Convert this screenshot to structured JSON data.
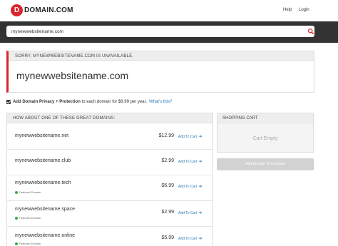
{
  "header": {
    "logo_badge": "D",
    "logo_text": "DOMAIN.COM",
    "nav": {
      "help": "Help",
      "login": "Login"
    }
  },
  "search": {
    "value": "mynewwebsitename.com",
    "icon": "search-icon"
  },
  "unavailable": {
    "message": "SORRY, MYNEWWEBSITENAME.COM IS UNAVAILABLE.",
    "domain": "mynewwebsitename.com"
  },
  "privacy": {
    "label_bold": "Add Domain Privacy + Protection",
    "label_rest": "to each domain for $8.99 per year.",
    "link": "What's this?"
  },
  "suggestions": {
    "header": "HOW ABOUT ONE OF THESE GREAT DOMAINS:",
    "items": [
      {
        "name": "mynewwebsitename.net",
        "price": "$12.99",
        "cta": "Add To Cart",
        "featured": ""
      },
      {
        "name": "mynewwebsitename.club",
        "price": "$2.99",
        "cta": "Add To Cart",
        "featured": ""
      },
      {
        "name": "mynewwebsitename.tech",
        "price": "$6.99",
        "cta": "Add To Cart",
        "featured": "Featured Domain"
      },
      {
        "name": "mynewwebsitename.space",
        "price": "$2.99",
        "cta": "Add To Cart",
        "featured": "Featured Domain"
      },
      {
        "name": "mynewwebsitename.online",
        "price": "$5.99",
        "cta": "Add To Cart",
        "featured": "Featured Domain"
      }
    ]
  },
  "cart": {
    "header": "SHOPPING CART",
    "empty": "Cart Empty",
    "button": "Add Domain To Continue"
  },
  "colors": {
    "brand_red": "#d8252c",
    "link_blue": "#2a7ab5",
    "featured_green": "#3aaa4a",
    "search_band": "#333333"
  }
}
